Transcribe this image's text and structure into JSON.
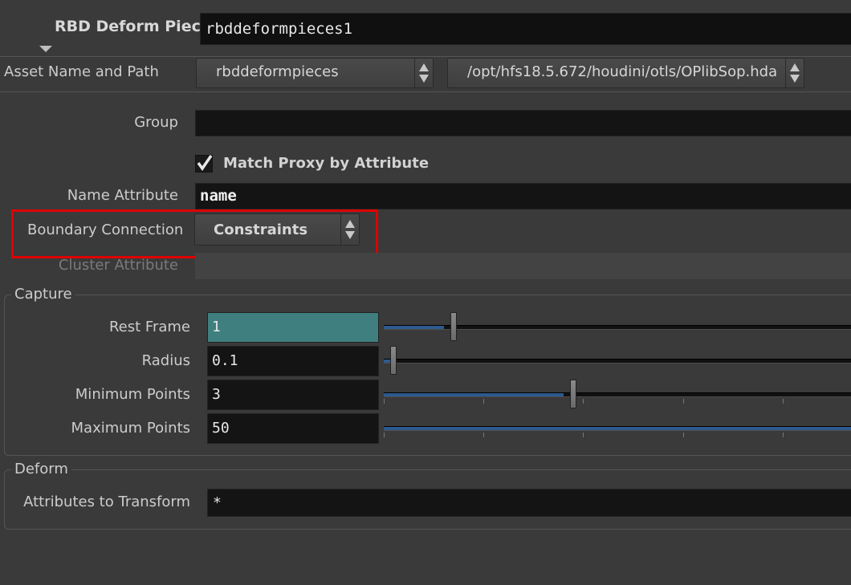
{
  "node": {
    "type_label": "RBD Deform Pieces",
    "name": "rbddeformpieces1"
  },
  "asset": {
    "label": "Asset Name and Path",
    "name_value": "rbddeformpieces",
    "path_value": "/opt/hfs18.5.672/houdini/otls/OPlibSop.hda"
  },
  "params": {
    "group_label": "Group",
    "group_value": "",
    "match_proxy_label": "Match Proxy by Attribute",
    "match_proxy_checked": true,
    "name_attr_label": "Name Attribute",
    "name_attr_value": "name",
    "boundary_label": "Boundary Connection",
    "boundary_value": "Constraints",
    "cluster_label": "Cluster Attribute",
    "cluster_value": ""
  },
  "capture": {
    "title": "Capture",
    "rows": [
      {
        "label": "Rest Frame",
        "value": "1",
        "slider_fraction": 0.2
      },
      {
        "label": "Radius",
        "value": "0.1",
        "slider_fraction": 0.0
      },
      {
        "label": "Minimum Points",
        "value": "3",
        "slider_fraction": 0.6
      },
      {
        "label": "Maximum Points",
        "value": "50",
        "slider_fraction": 1.0
      }
    ]
  },
  "deform": {
    "title": "Deform",
    "attrs_label": "Attributes to Transform",
    "attrs_value": "*"
  },
  "colors": {
    "highlight": "#e00000",
    "slider_fill": "#2d5a8f",
    "active_field": "#3f7f7f"
  },
  "icons": [
    "collapse-arrow-icon",
    "spinner-arrows-icon",
    "checkmark-icon"
  ]
}
